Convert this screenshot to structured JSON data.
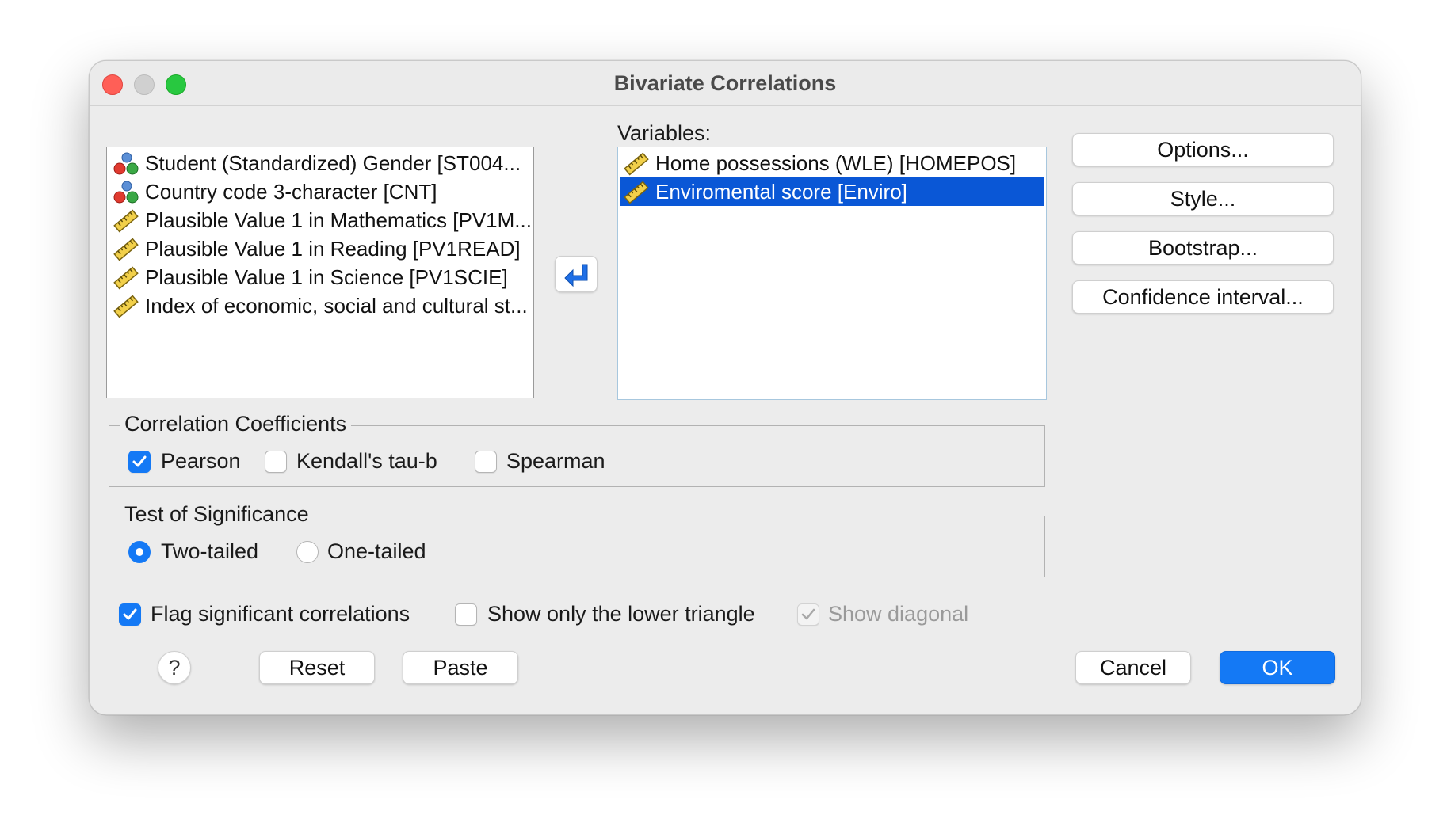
{
  "window": {
    "title": "Bivariate Correlations"
  },
  "source_list": {
    "items": [
      {
        "label": "Student (Standardized) Gender [ST004...",
        "icon": "nominal-variable-icon"
      },
      {
        "label": "Country code 3-character [CNT]",
        "icon": "nominal-variable-icon"
      },
      {
        "label": "Plausible Value 1 in Mathematics [PV1M...",
        "icon": "scale-variable-icon"
      },
      {
        "label": "Plausible Value 1 in Reading [PV1READ]",
        "icon": "scale-variable-icon"
      },
      {
        "label": "Plausible Value 1 in Science [PV1SCIE]",
        "icon": "scale-variable-icon"
      },
      {
        "label": "Index of economic, social and cultural st...",
        "icon": "scale-variable-icon"
      }
    ]
  },
  "variables": {
    "label": "Variables:",
    "items": [
      {
        "label": "Home possessions (WLE) [HOMEPOS]",
        "icon": "scale-variable-icon",
        "selected": false
      },
      {
        "label": "Enviromental score [Enviro]",
        "icon": "scale-variable-icon",
        "selected": true
      }
    ]
  },
  "side_buttons": {
    "options": "Options...",
    "style": "Style...",
    "bootstrap": "Bootstrap...",
    "confidence": "Confidence interval..."
  },
  "correlation_coefficients": {
    "legend": "Correlation Coefficients",
    "pearson": "Pearson",
    "kendall": "Kendall's tau-b",
    "spearman": "Spearman",
    "pearson_checked": true,
    "kendall_checked": false,
    "spearman_checked": false
  },
  "test_of_significance": {
    "legend": "Test of Significance",
    "two_tailed": "Two-tailed",
    "one_tailed": "One-tailed",
    "selected": "two_tailed"
  },
  "flags": {
    "flag_significant": "Flag significant correlations",
    "lower_triangle": "Show only the lower triangle",
    "show_diagonal": "Show diagonal",
    "flag_significant_checked": true,
    "lower_triangle_checked": false,
    "show_diagonal_checked": true,
    "show_diagonal_enabled": false
  },
  "footer": {
    "help": "?",
    "reset": "Reset",
    "paste": "Paste",
    "cancel": "Cancel",
    "ok": "OK"
  },
  "colors": {
    "accent": "#1479f5",
    "selection": "#0a57d6",
    "close": "#ff5f57",
    "maximize": "#28c840"
  }
}
